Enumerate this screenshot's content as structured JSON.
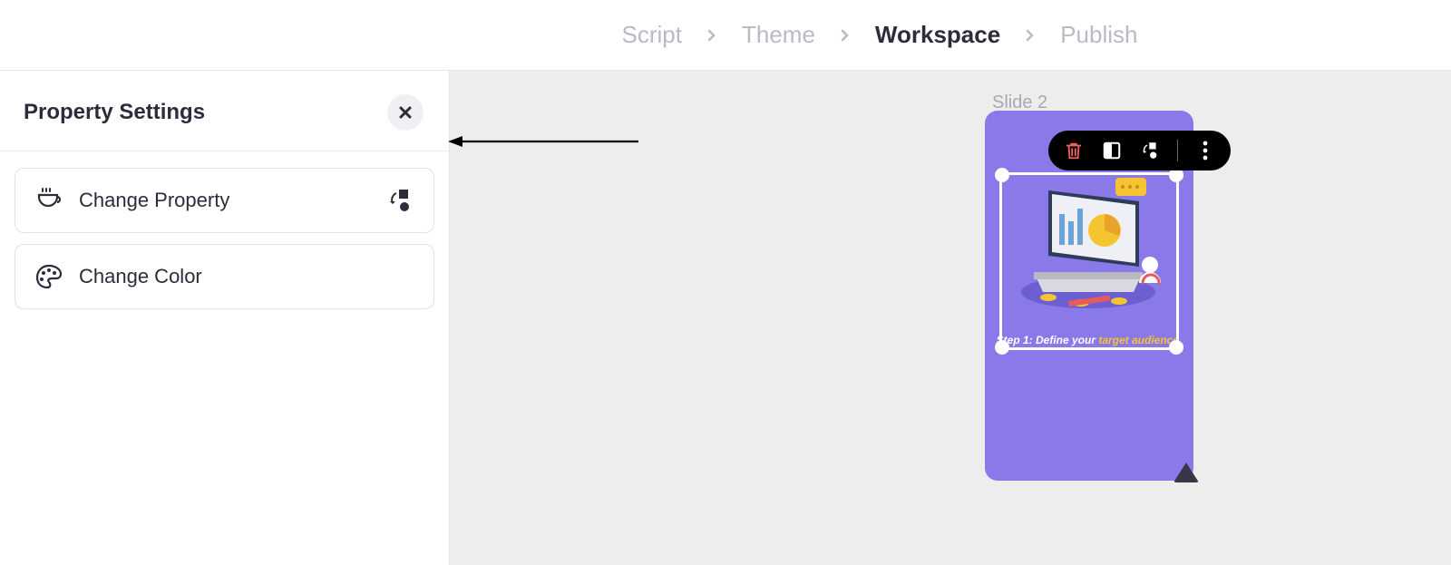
{
  "breadcrumb": {
    "items": [
      {
        "label": "Script",
        "active": false
      },
      {
        "label": "Theme",
        "active": false
      },
      {
        "label": "Workspace",
        "active": true
      },
      {
        "label": "Publish",
        "active": false
      }
    ]
  },
  "sidebar": {
    "title": "Property Settings",
    "items": [
      {
        "label": "Change Property",
        "leading_icon": "cup-icon",
        "trailing_icon": "change-property-icon"
      },
      {
        "label": "Change Color",
        "leading_icon": "palette-icon"
      }
    ]
  },
  "canvas": {
    "slide_label": "Slide 2",
    "caption_plain": "Step 1: Define your ",
    "caption_highlight": "target audience.",
    "colors": {
      "slide_bg": "#8a79e8",
      "caption_highlight": "#f4c431"
    }
  },
  "float_toolbar": {
    "icons": [
      "delete-icon",
      "layout-icon",
      "change-property-icon",
      "more-icon"
    ]
  }
}
